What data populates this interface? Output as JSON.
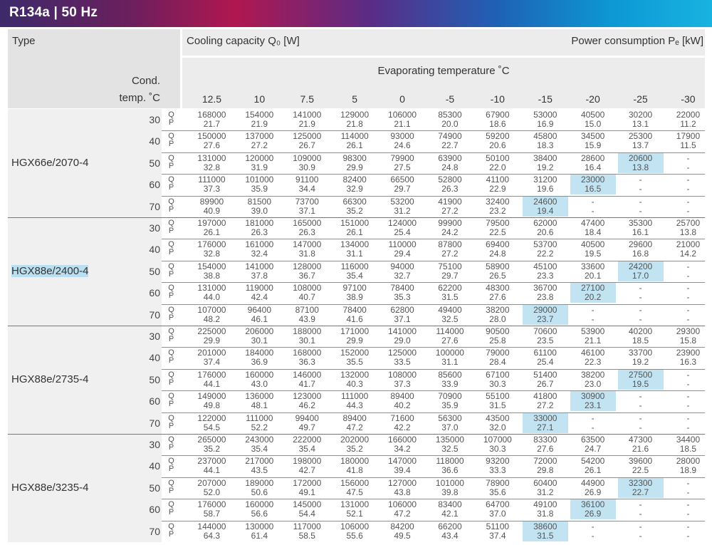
{
  "title": "R134a | 50 Hz",
  "header": {
    "type_label": "Type",
    "cooling_label": "Cooling capacity  Q₀  [W]",
    "power_label": "Power consumption  Pₑ  [kW]",
    "evap_label": "Evaporating temperature ˚C",
    "cond_label_1": "Cond.",
    "cond_label_2": "temp. ˚C",
    "evap_temps": [
      "12.5",
      "10",
      "7.5",
      "5",
      "0",
      "-5",
      "-10",
      "-15",
      "-20",
      "-25",
      "-30"
    ]
  },
  "row_labels": {
    "q": "Q",
    "p": "P"
  },
  "models": [
    {
      "name": "HGX66e/2070-4",
      "rows": [
        {
          "cond": "30",
          "q": [
            "168000",
            "154000",
            "141000",
            "129000",
            "106000",
            "85300",
            "67900",
            "53000",
            "40500",
            "30200",
            "22000"
          ],
          "p": [
            "21.7",
            "21.9",
            "21.9",
            "21.8",
            "21.1",
            "20.0",
            "18.6",
            "16.9",
            "15.0",
            "13.1",
            "11.2"
          ]
        },
        {
          "cond": "40",
          "q": [
            "150000",
            "137000",
            "125000",
            "114000",
            "93000",
            "74900",
            "59200",
            "45800",
            "34500",
            "25300",
            "17900"
          ],
          "p": [
            "27.6",
            "27.2",
            "26.7",
            "26.1",
            "24.6",
            "22.7",
            "20.6",
            "18.3",
            "15.9",
            "13.7",
            "11.5"
          ]
        },
        {
          "cond": "50",
          "q": [
            "131000",
            "120000",
            "109000",
            "98300",
            "79900",
            "63900",
            "50100",
            "38400",
            "28600",
            "20600",
            "-"
          ],
          "p": [
            "32.8",
            "31.9",
            "30.9",
            "29.9",
            "27.5",
            "24.8",
            "22.0",
            "19.2",
            "16.4",
            "13.8",
            "-"
          ],
          "hl": 9
        },
        {
          "cond": "60",
          "q": [
            "111000",
            "101000",
            "91100",
            "82400",
            "66500",
            "52800",
            "41100",
            "31200",
            "23000",
            "-",
            "-"
          ],
          "p": [
            "37.3",
            "35.9",
            "34.4",
            "32.9",
            "29.7",
            "26.3",
            "22.9",
            "19.6",
            "16.5",
            "-",
            "-"
          ],
          "hl": 8
        },
        {
          "cond": "70",
          "q": [
            "89900",
            "81500",
            "73700",
            "66300",
            "53200",
            "41900",
            "32400",
            "24600",
            "-",
            "-",
            "-"
          ],
          "p": [
            "40.9",
            "39.0",
            "37.1",
            "35.2",
            "31.2",
            "27.2",
            "23.2",
            "19.4",
            "-",
            "-",
            "-"
          ],
          "hl": 7
        }
      ]
    },
    {
      "name": "HGX88e/2400-4",
      "rows": [
        {
          "cond": "30",
          "q": [
            "197000",
            "181000",
            "165000",
            "151000",
            "124000",
            "99900",
            "79500",
            "62000",
            "47400",
            "35300",
            "25700"
          ],
          "p": [
            "26.1",
            "26.3",
            "26.3",
            "26.1",
            "25.4",
            "24.2",
            "22.5",
            "20.6",
            "18.4",
            "16.1",
            "13.8"
          ]
        },
        {
          "cond": "40",
          "q": [
            "176000",
            "161000",
            "147000",
            "134000",
            "110000",
            "87800",
            "69400",
            "53700",
            "40500",
            "29600",
            "21000"
          ],
          "p": [
            "32.8",
            "32.4",
            "31.8",
            "31.1",
            "29.4",
            "27.2",
            "24.8",
            "22.2",
            "19.5",
            "16.8",
            "14.2"
          ]
        },
        {
          "cond": "50",
          "q": [
            "154000",
            "141000",
            "128000",
            "116000",
            "94000",
            "75100",
            "58900",
            "45100",
            "33600",
            "24200",
            "-"
          ],
          "p": [
            "38.8",
            "37.8",
            "36.7",
            "35.4",
            "32.7",
            "29.7",
            "26.5",
            "23.3",
            "20.1",
            "17.0",
            "-"
          ],
          "hl": 9
        },
        {
          "cond": "60",
          "q": [
            "131000",
            "119000",
            "108000",
            "97100",
            "78400",
            "62200",
            "48300",
            "36700",
            "27100",
            "-",
            "-"
          ],
          "p": [
            "44.0",
            "42.4",
            "40.7",
            "38.9",
            "35.3",
            "31.5",
            "27.6",
            "23.8",
            "20.2",
            "-",
            "-"
          ],
          "hl": 8
        },
        {
          "cond": "70",
          "q": [
            "107000",
            "96400",
            "87100",
            "78400",
            "62800",
            "49400",
            "38200",
            "29000",
            "-",
            "-",
            "-"
          ],
          "p": [
            "48.2",
            "46.1",
            "43.9",
            "41.6",
            "37.1",
            "32.5",
            "28.0",
            "23.7",
            "-",
            "-",
            "-"
          ],
          "hl": 7
        }
      ]
    },
    {
      "name": "HGX88e/2735-4",
      "rows": [
        {
          "cond": "30",
          "q": [
            "225000",
            "206000",
            "188000",
            "171000",
            "141000",
            "114000",
            "90500",
            "70600",
            "53900",
            "40200",
            "29300"
          ],
          "p": [
            "29.9",
            "30.1",
            "30.1",
            "29.9",
            "29.0",
            "27.6",
            "25.8",
            "23.5",
            "21.1",
            "18.5",
            "15.8"
          ]
        },
        {
          "cond": "40",
          "q": [
            "201000",
            "184000",
            "168000",
            "152000",
            "125000",
            "100000",
            "79000",
            "61100",
            "46100",
            "33700",
            "23900"
          ],
          "p": [
            "37.4",
            "36.9",
            "36.3",
            "35.5",
            "33.5",
            "31.1",
            "28.4",
            "25.4",
            "22.3",
            "19.2",
            "16.3"
          ]
        },
        {
          "cond": "50",
          "q": [
            "176000",
            "160000",
            "146000",
            "132000",
            "108000",
            "85600",
            "67100",
            "51400",
            "38200",
            "27500",
            "-"
          ],
          "p": [
            "44.1",
            "43.0",
            "41.7",
            "40.3",
            "37.3",
            "33.9",
            "30.3",
            "26.7",
            "23.0",
            "19.5",
            "-"
          ],
          "hl": 9
        },
        {
          "cond": "60",
          "q": [
            "149000",
            "136000",
            "123000",
            "111000",
            "89400",
            "70900",
            "55100",
            "41800",
            "30900",
            "-",
            "-"
          ],
          "p": [
            "49.8",
            "48.1",
            "46.2",
            "44.3",
            "40.2",
            "35.9",
            "31.5",
            "27.2",
            "23.1",
            "-",
            "-"
          ],
          "hl": 8
        },
        {
          "cond": "70",
          "q": [
            "122000",
            "111000",
            "99400",
            "89400",
            "71600",
            "56300",
            "43500",
            "33000",
            "-",
            "-",
            "-"
          ],
          "p": [
            "54.5",
            "52.2",
            "49.7",
            "47.2",
            "42.2",
            "37.0",
            "32.0",
            "27.1",
            "-",
            "-",
            "-"
          ],
          "hl": 7
        }
      ]
    },
    {
      "name": "HGX88e/3235-4",
      "rows": [
        {
          "cond": "30",
          "q": [
            "265000",
            "243000",
            "222000",
            "202000",
            "166000",
            "135000",
            "107000",
            "83300",
            "63500",
            "47300",
            "34400"
          ],
          "p": [
            "35.2",
            "35.4",
            "35.4",
            "35.2",
            "34.2",
            "32.5",
            "30.3",
            "27.6",
            "24.7",
            "21.6",
            "18.5"
          ]
        },
        {
          "cond": "40",
          "q": [
            "237000",
            "217000",
            "198000",
            "180000",
            "147000",
            "118000",
            "93200",
            "72000",
            "54200",
            "39600",
            "28000"
          ],
          "p": [
            "44.1",
            "43.5",
            "42.7",
            "41.8",
            "39.4",
            "36.6",
            "33.3",
            "29.8",
            "26.1",
            "22.5",
            "18.9"
          ]
        },
        {
          "cond": "50",
          "q": [
            "207000",
            "189000",
            "172000",
            "156000",
            "127000",
            "101000",
            "78900",
            "60400",
            "44900",
            "32300",
            "-"
          ],
          "p": [
            "52.0",
            "50.6",
            "49.1",
            "47.5",
            "43.8",
            "39.8",
            "35.6",
            "31.2",
            "26.9",
            "22.7",
            "-"
          ],
          "hl": 9
        },
        {
          "cond": "60",
          "q": [
            "176000",
            "160000",
            "145000",
            "131000",
            "106000",
            "83400",
            "64700",
            "49100",
            "36100",
            "-",
            "-"
          ],
          "p": [
            "58.7",
            "56.6",
            "54.4",
            "52.1",
            "47.2",
            "42.1",
            "37.0",
            "31.8",
            "26.9",
            "-",
            "-"
          ],
          "hl": 8
        },
        {
          "cond": "70",
          "q": [
            "144000",
            "130000",
            "117000",
            "106000",
            "84200",
            "66200",
            "51100",
            "38600",
            "-",
            "-",
            "-"
          ],
          "p": [
            "64.3",
            "61.4",
            "58.5",
            "55.6",
            "49.5",
            "43.4",
            "37.4",
            "31.5",
            "-",
            "-",
            "-"
          ],
          "hl": 7
        }
      ]
    }
  ]
}
